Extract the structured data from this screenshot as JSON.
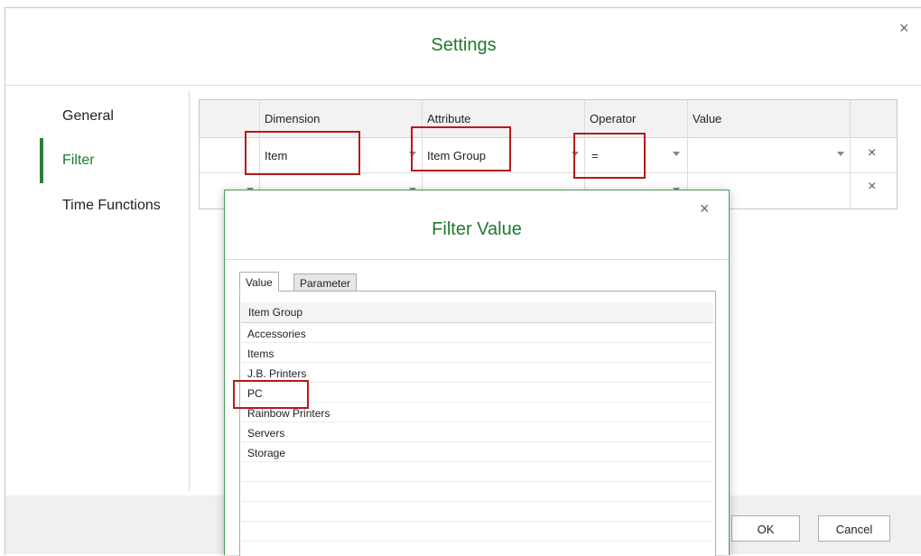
{
  "settings": {
    "title": "Settings",
    "close_symbol": "×",
    "nav": {
      "general": "General",
      "filter": "Filter",
      "time_functions": "Time Functions"
    },
    "grid": {
      "headers": {
        "dimension": "Dimension",
        "attribute": "Attribute",
        "operator": "Operator",
        "value": "Value"
      },
      "row1": {
        "dimension": "Item",
        "attribute": "Item Group",
        "operator": "=",
        "value": ""
      },
      "delete_symbol": "×"
    },
    "footer": {
      "ok": "OK",
      "cancel": "Cancel"
    }
  },
  "filter_value": {
    "title": "Filter Value",
    "close_symbol": "×",
    "tabs": {
      "value": "Value",
      "parameter": "Parameter"
    },
    "list_header": "Item Group",
    "items": [
      "Accessories",
      "Items",
      "J.B. Printers",
      "PC",
      "Rainbow Printers",
      "Servers",
      "Storage"
    ]
  },
  "colors": {
    "accent_green": "#1e7a2f",
    "highlight_red": "#b51a1a"
  },
  "icons": [
    "close-icon",
    "dropdown-caret-icon",
    "delete-row-icon"
  ]
}
